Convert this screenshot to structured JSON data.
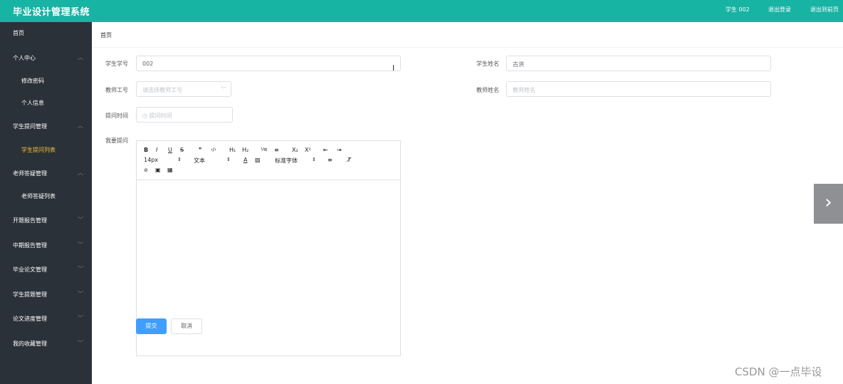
{
  "header": {
    "app_title": "毕业设计管理系统",
    "user": "学生 002",
    "logout": "退出登录",
    "exit_front": "退出到前页"
  },
  "sidebar": {
    "items": [
      {
        "label": "首页",
        "level": 1,
        "arrow": "",
        "active": false
      },
      {
        "label": "个人中心",
        "level": 1,
        "arrow": "up",
        "active": false
      },
      {
        "label": "修改密码",
        "level": 2,
        "arrow": "",
        "active": false
      },
      {
        "label": "个人信息",
        "level": 2,
        "arrow": "",
        "active": false
      },
      {
        "label": "学生提问管理",
        "level": 1,
        "arrow": "up",
        "active": false
      },
      {
        "label": "学生提问列表",
        "level": 2,
        "arrow": "",
        "active": true
      },
      {
        "label": "老师答疑管理",
        "level": 1,
        "arrow": "up",
        "active": false
      },
      {
        "label": "老师答疑列表",
        "level": 2,
        "arrow": "",
        "active": false
      },
      {
        "label": "开题报告管理",
        "level": 1,
        "arrow": "down",
        "active": false
      },
      {
        "label": "中期报告管理",
        "level": 1,
        "arrow": "down",
        "active": false
      },
      {
        "label": "毕业论文管理",
        "level": 1,
        "arrow": "down",
        "active": false
      },
      {
        "label": "学生提题管理",
        "level": 1,
        "arrow": "down",
        "active": false
      },
      {
        "label": "论文进度管理",
        "level": 1,
        "arrow": "down",
        "active": false
      },
      {
        "label": "我的收藏管理",
        "level": 1,
        "arrow": "down",
        "active": false
      }
    ]
  },
  "breadcrumb": "首页",
  "form": {
    "student_no_label": "学生学号",
    "student_no_value": "002",
    "student_name_label": "学生姓名",
    "student_name_value": "古洪",
    "teacher_no_label": "教师工号",
    "teacher_no_placeholder": "请选择教师工号",
    "teacher_name_label": "教师姓名",
    "teacher_name_placeholder": "教师姓名",
    "ask_time_label": "提问时间",
    "ask_time_placeholder": "提问时间",
    "question_label": "我要提问"
  },
  "editor_toolbar": {
    "bold": "B",
    "italic": "I",
    "underline": "U",
    "strike": "S",
    "quote": "❞",
    "code": "‹/›",
    "h1": "H₁",
    "h2": "H₂",
    "ol": "⅟≡",
    "ul": "≡",
    "sub": "X₂",
    "sup": "X²",
    "indent_dec": "⇤",
    "indent_inc": "⇥",
    "font_size": "14px",
    "text_type": "文本",
    "font_family": "标准字体",
    "color": "A",
    "bg": "▨",
    "align": "≡",
    "clean": "T̸",
    "link": "🔗",
    "image": "▣",
    "video": "▦"
  },
  "buttons": {
    "submit": "提交",
    "cancel": "取消"
  },
  "watermark": "CSDN @一点毕设",
  "colors": {
    "header": "#17b3a3",
    "sidebar": "#2a3139",
    "active_item": "#f4c136",
    "primary": "#409eff"
  }
}
